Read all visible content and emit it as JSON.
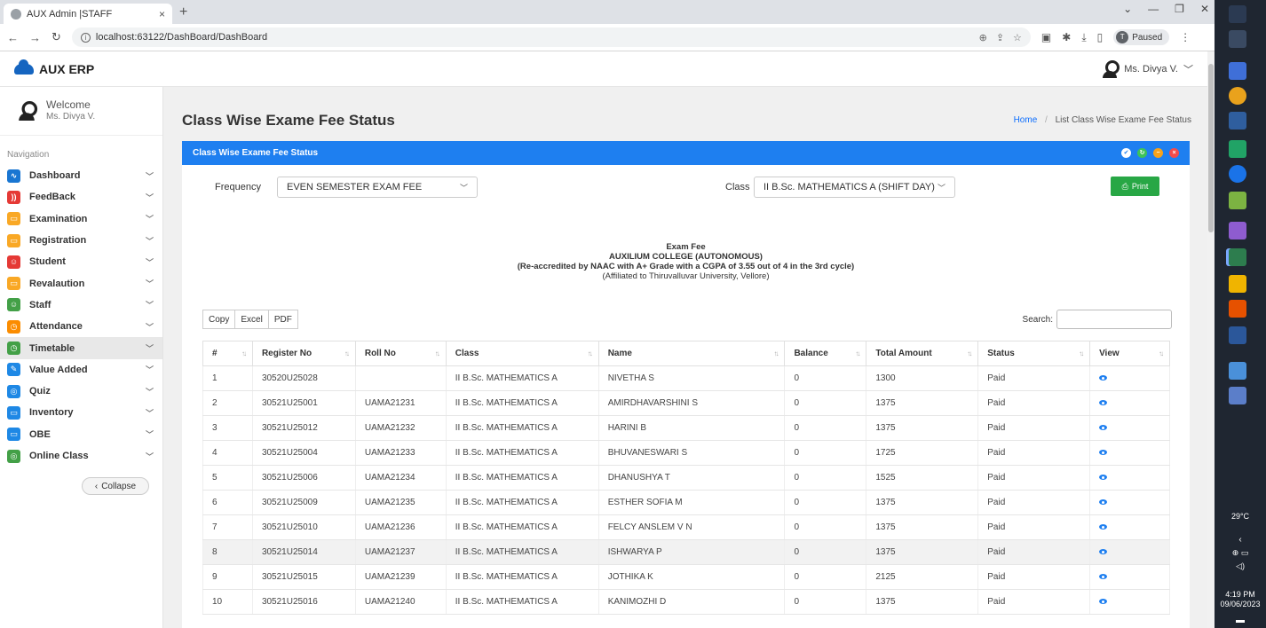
{
  "browser": {
    "tab_title": "AUX Admin |STAFF",
    "tab_close": "×",
    "new_tab": "+",
    "url": "localhost:63122/DashBoard/DashBoard",
    "profile_status": "Paused",
    "profile_initial": "T",
    "info_glyph": "i"
  },
  "app": {
    "name": "AUX ERP",
    "user": "Ms. Divya V."
  },
  "sidebar": {
    "welcome": "Welcome",
    "user": "Ms. Divya V.",
    "nav_caption": "Navigation",
    "items": [
      {
        "label": "Dashboard",
        "color": "#1976d2",
        "glyph": "∿"
      },
      {
        "label": "FeedBack",
        "color": "#e53935",
        "glyph": "))"
      },
      {
        "label": "Examination",
        "color": "#f9a825",
        "glyph": "▭"
      },
      {
        "label": "Registration",
        "color": "#f9a825",
        "glyph": "▭"
      },
      {
        "label": "Student",
        "color": "#e53935",
        "glyph": "☺"
      },
      {
        "label": "Revalaution",
        "color": "#f9a825",
        "glyph": "▭"
      },
      {
        "label": "Staff",
        "color": "#43a047",
        "glyph": "☺"
      },
      {
        "label": "Attendance",
        "color": "#fb8c00",
        "glyph": "◷"
      },
      {
        "label": "Timetable",
        "color": "#43a047",
        "glyph": "◷"
      },
      {
        "label": "Value Added",
        "color": "#1e88e5",
        "glyph": "✎"
      },
      {
        "label": "Quiz",
        "color": "#1e88e5",
        "glyph": "◎"
      },
      {
        "label": "Inventory",
        "color": "#1e88e5",
        "glyph": "▭"
      },
      {
        "label": "OBE",
        "color": "#1e88e5",
        "glyph": "▭"
      },
      {
        "label": "Online Class",
        "color": "#43a047",
        "glyph": "◎"
      }
    ],
    "active_item": "Timetable",
    "collapse_label": "Collapse"
  },
  "page": {
    "title": "Class Wise Exame Fee Status",
    "breadcrumb_home": "Home",
    "breadcrumb_sep": "/",
    "breadcrumb_current": "List Class Wise Exame Fee Status",
    "card_title": "Class Wise Exame Fee Status"
  },
  "filters": {
    "frequency_label": "Frequency",
    "frequency_value": "EVEN SEMESTER EXAM FEE",
    "class_label": "Class",
    "class_value": "II B.Sc. MATHEMATICS A (SHIFT DAY)",
    "print_label": "Print"
  },
  "report": {
    "line1": "Exam Fee",
    "line2": "AUXILIUM COLLEGE (AUTONOMOUS)",
    "line3": "(Re-accredited by NAAC with A+ Grade with a CGPA of 3.55 out of 4 in the 3rd cycle)",
    "line4": "(Affiliated to Thiruvalluvar University, Vellore)"
  },
  "table_tools": {
    "copy": "Copy",
    "excel": "Excel",
    "pdf": "PDF",
    "search_label": "Search:"
  },
  "table": {
    "columns": [
      "#",
      "Register No",
      "Roll No",
      "Class",
      "Name",
      "Balance",
      "Total Amount",
      "Status",
      "View"
    ],
    "rows": [
      [
        "1",
        "30520U25028",
        "",
        "II B.Sc. MATHEMATICS A",
        "NIVETHA S",
        "0",
        "1300",
        "Paid"
      ],
      [
        "2",
        "30521U25001",
        "UAMA21231",
        "II B.Sc. MATHEMATICS A",
        "AMIRDHAVARSHINI S",
        "0",
        "1375",
        "Paid"
      ],
      [
        "3",
        "30521U25012",
        "UAMA21232",
        "II B.Sc. MATHEMATICS A",
        "HARINI B",
        "0",
        "1375",
        "Paid"
      ],
      [
        "4",
        "30521U25004",
        "UAMA21233",
        "II B.Sc. MATHEMATICS A",
        "BHUVANESWARI S",
        "0",
        "1725",
        "Paid"
      ],
      [
        "5",
        "30521U25006",
        "UAMA21234",
        "II B.Sc. MATHEMATICS A",
        "DHANUSHYA T",
        "0",
        "1525",
        "Paid"
      ],
      [
        "6",
        "30521U25009",
        "UAMA21235",
        "II B.Sc. MATHEMATICS A",
        "ESTHER SOFIA M",
        "0",
        "1375",
        "Paid"
      ],
      [
        "7",
        "30521U25010",
        "UAMA21236",
        "II B.Sc. MATHEMATICS A",
        "FELCY ANSLEM V N",
        "0",
        "1375",
        "Paid"
      ],
      [
        "8",
        "30521U25014",
        "UAMA21237",
        "II B.Sc. MATHEMATICS A",
        "ISHWARYA P",
        "0",
        "1375",
        "Paid"
      ],
      [
        "9",
        "30521U25015",
        "UAMA21239",
        "II B.Sc. MATHEMATICS A",
        "JOTHIKA K",
        "0",
        "2125",
        "Paid"
      ],
      [
        "10",
        "30521U25016",
        "UAMA21240",
        "II B.Sc. MATHEMATICS A",
        "KANIMOZHI D",
        "0",
        "1375",
        "Paid"
      ]
    ],
    "highlighted_row": 8
  },
  "taskbar": {
    "temperature": "29°C",
    "time": "4:19 PM",
    "date": "09/06/2023"
  },
  "colors": {
    "card_header": "#1e7ff0",
    "print_button": "#28a745",
    "link": "#0d6efd"
  }
}
